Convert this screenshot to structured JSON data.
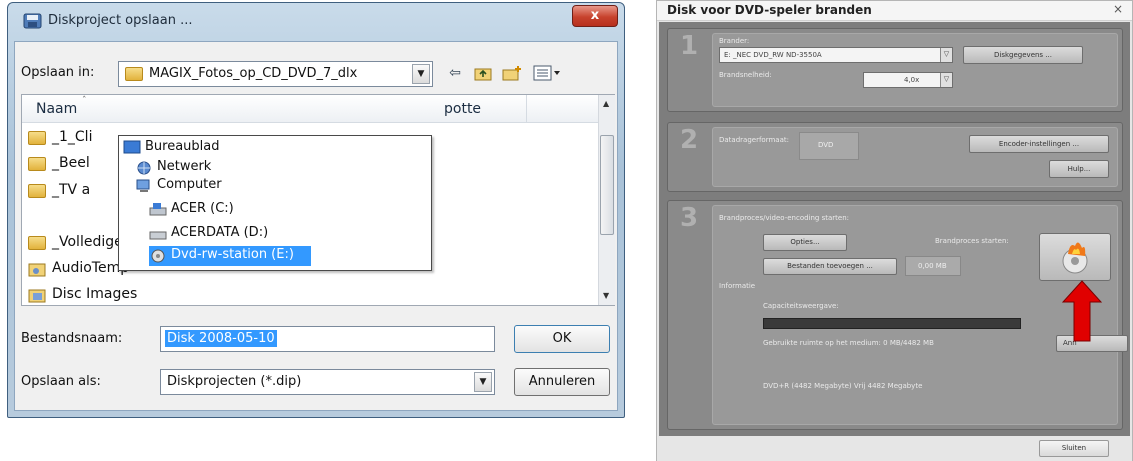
{
  "save_dialog": {
    "title": "Diskproject opslaan ...",
    "close_label": "x",
    "save_in_label": "Opslaan in:",
    "save_in_value": "MAGIX_Fotos_op_CD_DVD_7_dlx",
    "column_name": "Naam",
    "column_partial": "potte",
    "files": [
      {
        "name": "_1_Cli"
      },
      {
        "name": "_Beel"
      },
      {
        "name": "_TV a"
      },
      {
        "name": "_Volledige_demo"
      },
      {
        "name": "AudioTemp"
      },
      {
        "name": "Disc Images"
      }
    ],
    "dropdown_items": [
      {
        "label": "Bureaublad",
        "icon": "desktop-icon"
      },
      {
        "label": "Netwerk",
        "icon": "network-icon"
      },
      {
        "label": "Computer",
        "icon": "computer-icon"
      },
      {
        "label": "ACER (C:)",
        "icon": "drive-icon"
      },
      {
        "label": "ACERDATA (D:)",
        "icon": "drive-icon"
      },
      {
        "label": "Dvd-rw-station (E:)",
        "icon": "dvd-drive-icon"
      }
    ],
    "filename_label": "Bestandsnaam:",
    "filename_value": "Disk 2008-05-10",
    "saveas_label": "Opslaan als:",
    "saveas_value": "Diskprojecten (*.dip)",
    "ok_label": "OK",
    "cancel_label": "Annuleren"
  },
  "burn_dialog": {
    "title": "Disk voor DVD-speler branden",
    "close_label": "×",
    "step1": {
      "number": "1",
      "burner_label": "Brander:",
      "burner_value": "E: _NEC DVD_RW ND-3550A",
      "disc_info_button": "Diskgegevens ...",
      "speed_label": "Brandsnelheid:",
      "speed_value": "4,0x"
    },
    "step2": {
      "number": "2",
      "format_label": "Datadragerformaat:",
      "format_value": "DVD",
      "encoder_button": "Encoder-instellingen ...",
      "help_button": "Hulp..."
    },
    "step3": {
      "number": "3",
      "heading": "Brandproces/video-encoding starten:",
      "options_button": "Opties...",
      "start_label": "Brandproces starten:",
      "add_files_button": "Bestanden toevoegen ...",
      "size_value": "0,00 MB",
      "info_label": "Informatie",
      "capacity_label": "Capaciteitsweergave:",
      "usage_text": "Gebruikte ruimte op het medium: 0 MB/4482 MB",
      "partial_button": "Ann",
      "free_text": "DVD+R (4482 Megabyte) Vrij 4482 Megabyte",
      "capacity_used_fraction": 0.0
    },
    "close_button": "Sluiten"
  },
  "colors": {
    "arrow": "#e00000",
    "selection": "#3399ff"
  }
}
